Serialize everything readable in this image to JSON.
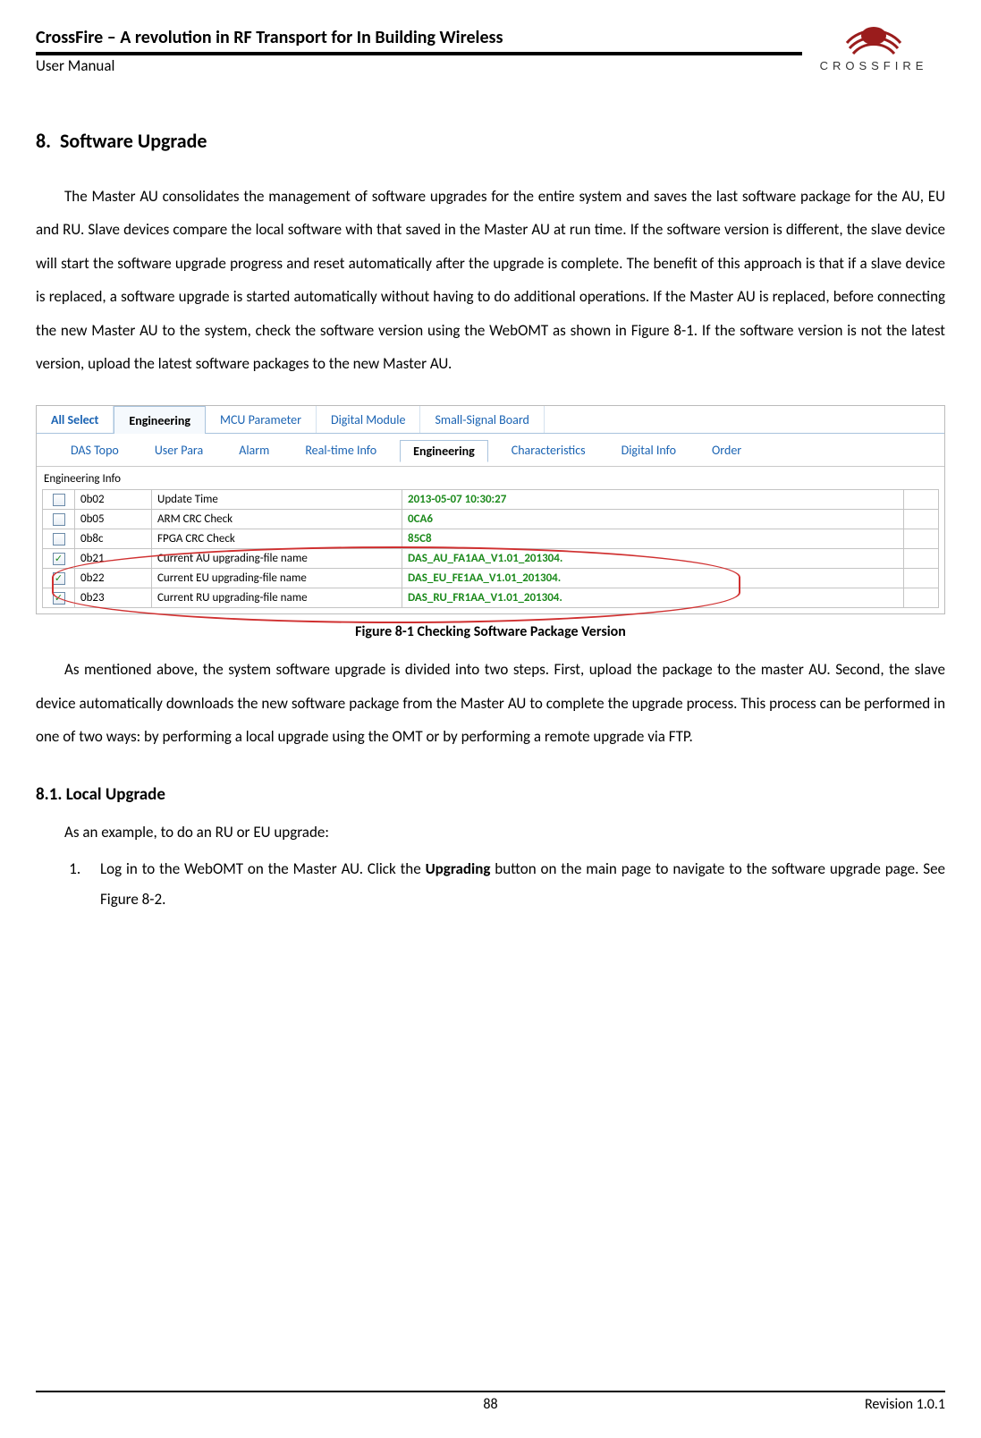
{
  "header": {
    "title": "CrossFire – A revolution in RF Transport for In Building Wireless",
    "subtitle": "User Manual",
    "logo_text": "CROSSFIRE"
  },
  "section": {
    "number": "8.",
    "title": "Software Upgrade",
    "para1": "The Master AU consolidates the management of software upgrades for the entire system and saves the last software package for the AU, EU and RU. Slave devices compare the local software with that saved in the Master AU at run time. If the software version is different, the slave device will start the software upgrade progress and reset automatically after the upgrade is complete. The benefit of this approach is that if a slave device is replaced, a software upgrade is started automatically without having to do additional operations. If the Master AU is replaced, before connecting the new Master AU to the system, check the software version using the WebOMT as shown in Figure 8-1. If the software version is not the latest version, upload the latest software packages to the new Master AU."
  },
  "figure": {
    "tabs1": [
      "All Select",
      "Engineering",
      "MCU Parameter",
      "Digital Module",
      "Small-Signal Board"
    ],
    "tabs1_active": 1,
    "tabs2": [
      "DAS Topo",
      "User Para",
      "Alarm",
      "Real-time Info",
      "Engineering",
      "Characteristics",
      "Digital Info",
      "Order"
    ],
    "tabs2_active": 4,
    "panel_title": "Engineering Info",
    "rows": [
      {
        "checked": false,
        "code": "0b02",
        "label": "Update Time",
        "value": "2013-05-07 10:30:27"
      },
      {
        "checked": false,
        "code": "0b05",
        "label": "ARM CRC Check",
        "value": "0CA6"
      },
      {
        "checked": false,
        "code": "0b8c",
        "label": "FPGA CRC Check",
        "value": "85C8"
      },
      {
        "checked": true,
        "code": "0b21",
        "label": "Current AU upgrading-file name",
        "value": "DAS_AU_FA1AA_V1.01_201304."
      },
      {
        "checked": true,
        "code": "0b22",
        "label": "Current EU upgrading-file name",
        "value": "DAS_EU_FE1AA_V1.01_201304."
      },
      {
        "checked": true,
        "code": "0b23",
        "label": "Current RU upgrading-file name",
        "value": "DAS_RU_FR1AA_V1.01_201304."
      }
    ],
    "caption": "Figure 8-1 Checking Software Package Version"
  },
  "after_figure": {
    "para2": "As mentioned above, the system software upgrade is divided into two steps. First, upload the package to the master AU. Second, the slave device automatically downloads the new software package from the Master AU to complete the upgrade process. This process can be performed in one of two ways: by performing a local upgrade using the OMT or by performing a remote upgrade via FTP."
  },
  "subsection": {
    "number": "8.1.",
    "title": "Local Upgrade",
    "intro": "As an example, to do an RU or EU upgrade:",
    "step1_pre": "Log in to the WebOMT on the Master AU. Click the ",
    "step1_bold": "Upgrading",
    "step1_post": " button on the main page to navigate to the software upgrade page. See Figure 8-2."
  },
  "footer": {
    "page": "88",
    "rev": "Revision 1.0.1"
  }
}
